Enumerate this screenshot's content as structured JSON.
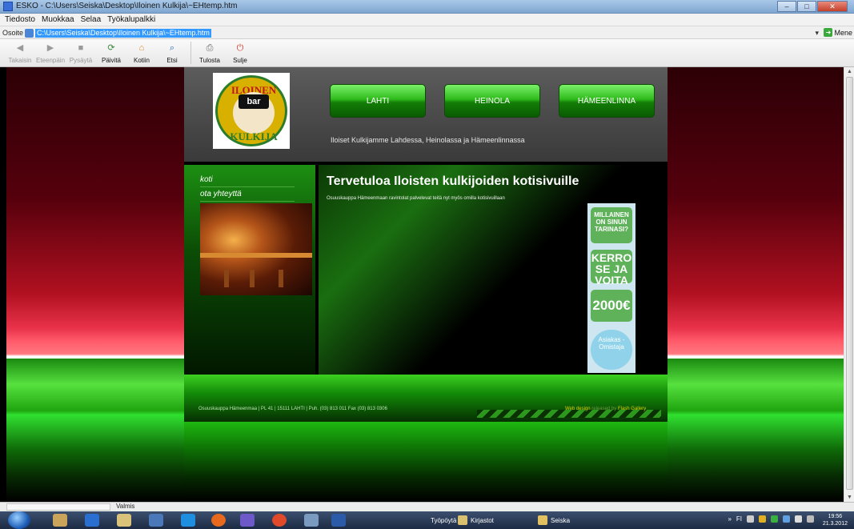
{
  "window": {
    "title": "ESKO - C:\\Users\\Seiska\\Desktop\\Iloinen Kulkija\\~EHtemp.htm",
    "minimize": "–",
    "maximize": "□",
    "close": "✕"
  },
  "menu": [
    "Tiedosto",
    "Muokkaa",
    "Selaa",
    "Työkalupalkki"
  ],
  "address": {
    "label": "Osoite",
    "value": "C:\\Users\\Seiska\\Desktop\\Iloinen Kulkija\\~EHtemp.htm",
    "go_label": "Mene"
  },
  "toolbar": [
    {
      "label": "Takaisin",
      "icon": "back-icon",
      "glyph": "◀",
      "color": "#9a9a9a",
      "enabled": false
    },
    {
      "label": "Eteenpäin",
      "icon": "forward-icon",
      "glyph": "▶",
      "color": "#9a9a9a",
      "enabled": false
    },
    {
      "label": "Pysäytä",
      "icon": "stop-icon",
      "glyph": "■",
      "color": "#9a9a9a",
      "enabled": false
    },
    {
      "label": "Päivitä",
      "icon": "refresh-icon",
      "glyph": "⟳",
      "color": "#3b8a3b",
      "enabled": true
    },
    {
      "label": "Kotiin",
      "icon": "home-icon",
      "glyph": "⌂",
      "color": "#d8891e",
      "enabled": true
    },
    {
      "label": "Etsi",
      "icon": "search-icon",
      "glyph": "⌕",
      "color": "#2a63b8",
      "enabled": true
    },
    {
      "label": "Tulosta",
      "icon": "print-icon",
      "glyph": "⎙",
      "color": "#666666",
      "enabled": true
    },
    {
      "label": "Sulje",
      "icon": "close-power-icon",
      "glyph": "⏻",
      "color": "#d23a2a",
      "enabled": true
    }
  ],
  "site": {
    "logo": {
      "top": "ILOINEN",
      "bottom": "KULKIJA",
      "hat": "bar"
    },
    "nav": [
      "LAHTI",
      "HEINOLA",
      "HÄMEENLINNA"
    ],
    "tagline": "Iloiset Kulkijamme Lahdessa, Heinolassa ja Hämeenlinnassa",
    "side_links": [
      "koti",
      "ota yhteyttä"
    ],
    "heading": "Tervetuloa Iloisten kulkijoiden kotisivuille",
    "intro": "Osuuskauppa Hämeenmaan ravintolat palvelevat teitä nyt myös omilla kotisivuillaan",
    "ad": {
      "line1": "MILLAINEN ON SINUN TARINASI?",
      "line2": "KERRO SE JA VOITA",
      "amount": "2000€",
      "brand": "Asiakas -Omistaja"
    },
    "footer": "Osuuskauppa Hämeenmaa | PL 41 | 15111 LAHTI | Puh. (03) 813 011 Fax (03) 813 0306",
    "credit_a": "Web design",
    "credit_b": "released by",
    "credit_c": "Flash Gallery"
  },
  "status": {
    "text": "Valmis"
  },
  "taskbar": {
    "tasks": [
      "Työpöytä",
      "Kirjastot",
      "Seiska"
    ],
    "tray_lang": "FI",
    "time": "19:56",
    "date": "21.3.2012"
  },
  "colors": {
    "nav_button": "#2fba1c",
    "title_bar": "#a9c8e8",
    "address_highlight": "#3399ff"
  }
}
